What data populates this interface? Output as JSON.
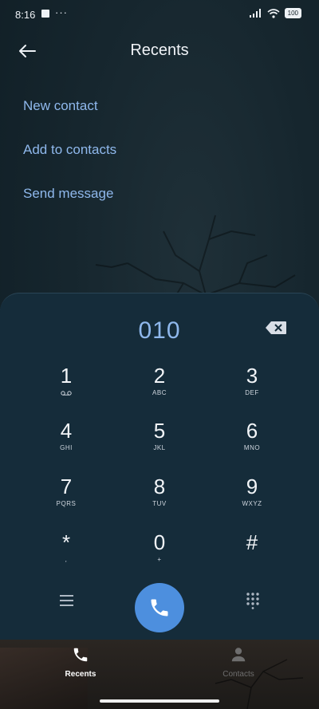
{
  "status_bar": {
    "time": "8:16",
    "dots": "···",
    "battery": "100"
  },
  "header": {
    "title": "Recents"
  },
  "actions": [
    {
      "label": "New contact"
    },
    {
      "label": "Add to contacts"
    },
    {
      "label": "Send message"
    }
  ],
  "dialer": {
    "number": "010",
    "keys": [
      {
        "digit": "1",
        "letters": ""
      },
      {
        "digit": "2",
        "letters": "ABC"
      },
      {
        "digit": "3",
        "letters": "DEF"
      },
      {
        "digit": "4",
        "letters": "GHI"
      },
      {
        "digit": "5",
        "letters": "JKL"
      },
      {
        "digit": "6",
        "letters": "MNO"
      },
      {
        "digit": "7",
        "letters": "PQRS"
      },
      {
        "digit": "8",
        "letters": "TUV"
      },
      {
        "digit": "9",
        "letters": "WXYZ"
      },
      {
        "digit": "*",
        "letters": ","
      },
      {
        "digit": "0",
        "letters": "+"
      },
      {
        "digit": "#",
        "letters": ""
      }
    ]
  },
  "nav": {
    "recents_label": "Recents",
    "contacts_label": "Contacts"
  },
  "colors": {
    "accent": "#8fb8ec",
    "call_button": "#4d8fde",
    "panel": "#152c3a"
  }
}
